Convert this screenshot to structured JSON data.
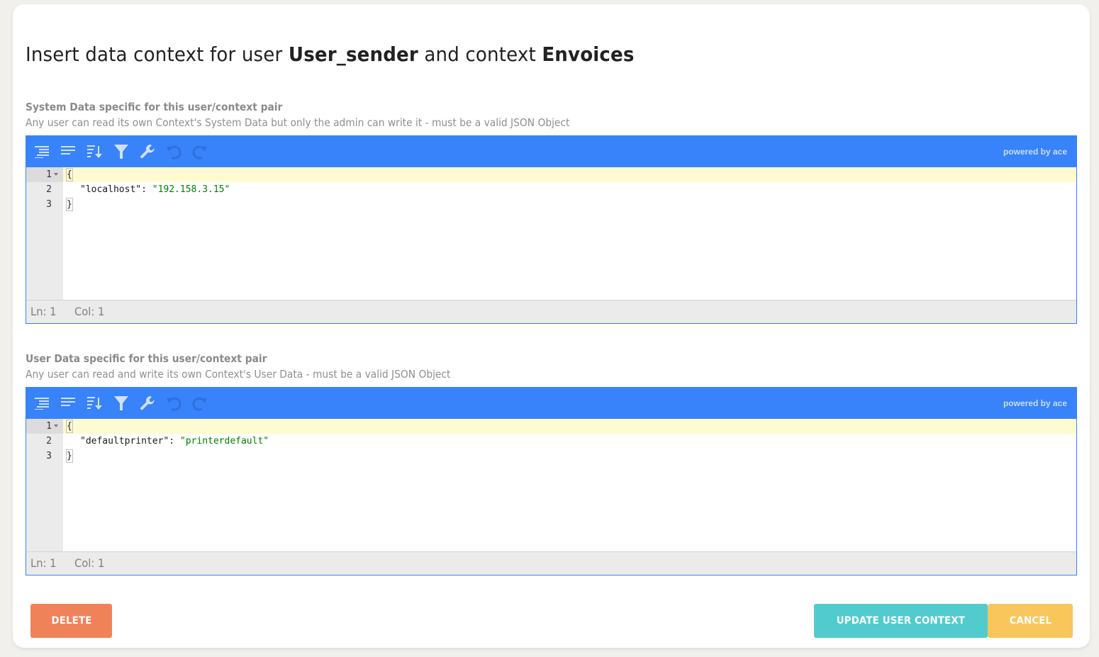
{
  "header": {
    "title_prefix": "Insert data context for user ",
    "user": "User_sender",
    "title_middle": " and context ",
    "context": "Envoices"
  },
  "system_section": {
    "label": "System Data specific for this user/context pair",
    "description": "Any user can read its own Context's System Data but only the admin can write it - must be a valid JSON Object",
    "editor": {
      "powered_by": "powered by ace",
      "toolbar": [
        "format-icon",
        "compact-icon",
        "sort-icon",
        "filter-icon",
        "repair-icon",
        "undo-icon",
        "redo-icon"
      ],
      "lines": [
        {
          "num": "1",
          "text": "{"
        },
        {
          "num": "2",
          "key": "\"localhost\"",
          "sep": ": ",
          "value": "\"192.158.3.15\""
        },
        {
          "num": "3",
          "text": "}"
        }
      ],
      "status": {
        "ln": "Ln: 1",
        "col": "Col: 1"
      }
    }
  },
  "user_section": {
    "label": "User Data specific for this user/context pair",
    "description": "Any user can read and write its own Context's User Data - must be a valid JSON Object",
    "editor": {
      "powered_by": "powered by ace",
      "lines": [
        {
          "num": "1",
          "text": "{"
        },
        {
          "num": "2",
          "key": "\"defaultprinter\"",
          "sep": ": ",
          "value": "\"printerdefault\""
        },
        {
          "num": "3",
          "text": "}"
        }
      ],
      "status": {
        "ln": "Ln: 1",
        "col": "Col: 1"
      }
    }
  },
  "buttons": {
    "delete": "DELETE",
    "update": "UPDATE USER CONTEXT",
    "cancel": "CANCEL"
  },
  "colors": {
    "toolbar": "#3883fa",
    "delete": "#f0825a",
    "update": "#52cbce",
    "cancel": "#f9c65c",
    "json_string": "#008000",
    "active_line": "#fffbd1"
  }
}
